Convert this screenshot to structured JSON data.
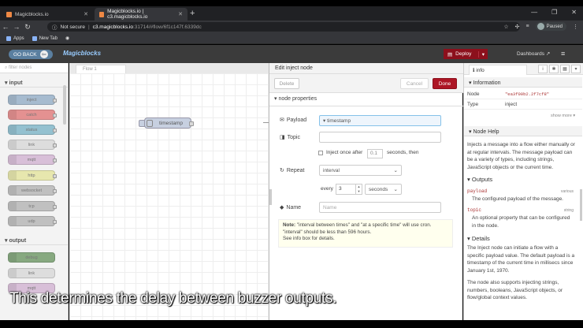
{
  "browser": {
    "tabs": [
      {
        "label": "Magicblocks.io",
        "active": false
      },
      {
        "label": "Magicblocks.io | c3.magicblocks.io",
        "active": true
      }
    ],
    "address": {
      "security": "Not secure",
      "host": "c3.magicblocks.io",
      "path": ":31714/#flow/6f1c147f.6339dc"
    },
    "bookmarks": [
      "Apps",
      "New Tab"
    ],
    "profile": "Paused"
  },
  "header": {
    "go_back": "GO BACK",
    "logo": "Magicblocks",
    "deploy": "Deploy",
    "dashboards": "Dashboards"
  },
  "palette": {
    "filter_placeholder": "filter nodes",
    "input_label": "input",
    "output_label": "output",
    "input_nodes": [
      "inject",
      "catch",
      "status",
      "link",
      "mqtt",
      "http",
      "websocket",
      "tcp",
      "udp"
    ],
    "output_nodes": [
      "debug",
      "link",
      "mqtt"
    ]
  },
  "workspace": {
    "tab": "Flow 1",
    "node": "timestamp"
  },
  "tray": {
    "title": "Edit inject node",
    "delete": "Delete",
    "cancel": "Cancel",
    "done": "Done",
    "section": "node properties",
    "payload_label": "Payload",
    "payload_value": "timestamp",
    "topic_label": "Topic",
    "inject_once": "Inject once after",
    "inject_delay": "0.1",
    "seconds_then": "seconds, then",
    "repeat_label": "Repeat",
    "repeat_value": "interval",
    "every_label": "every",
    "every_value": "3",
    "unit_value": "seconds",
    "name_label": "Name",
    "name_placeholder": "Name",
    "note_bold": "Note:",
    "note_text": " \"interval between times\" and \"at a specific time\" will use cron.",
    "note_line2": "\"interval\" should be less than 596 hours.",
    "note_line3": "See info box for details."
  },
  "sidebar": {
    "tab": "info",
    "info_heading": "Information",
    "node_key": "Node",
    "node_value": "\"ea3f00b2.2f7cf8\"",
    "type_key": "Type",
    "type_value": "inject",
    "show_more": "show more",
    "help_heading": "Node Help",
    "help_text": "Injects a message into a flow either manually or at regular intervals. The message payload can be a variety of types, including strings, JavaScript objects or the current time.",
    "outputs_heading": "Outputs",
    "payload_prop": "payload",
    "payload_type": "various",
    "payload_desc": "The configured payload of the message.",
    "topic_prop": "topic",
    "topic_type": "string",
    "topic_desc": "An optional property that can be configured in the node.",
    "details_heading": "Details",
    "details_text": "The Inject node can initiate a flow with a specific payload value. The default payload is a timestamp of the current time in millisecs since January 1st, 1970.",
    "details_text2": "The node also supports injecting strings, numbers, booleans, JavaScript objects, or flow/global context values."
  },
  "caption": "This determines the delay between buzzer outputs.",
  "colors": {
    "deploy": "#8c101c",
    "done": "#ad1625",
    "inject_node": "#c7d0e0"
  }
}
